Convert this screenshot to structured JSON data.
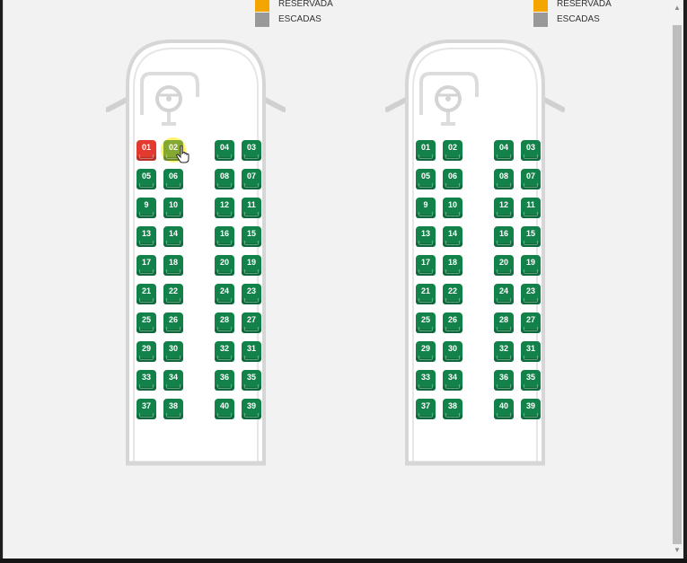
{
  "colors": {
    "available": "#12824a",
    "selected": "#e23a2f",
    "hover": "#84a830",
    "reserved": "#f5a500",
    "stairs": "#999999"
  },
  "legend": [
    {
      "label": "RESERVADA",
      "color": "#f5a500"
    },
    {
      "label": "ESCADAS",
      "color": "#999999"
    }
  ],
  "decks": [
    {
      "icons": [
        "steering-wheel-icon"
      ],
      "rows": [
        [
          "01",
          "02",
          "04",
          "03"
        ],
        [
          "05",
          "06",
          "08",
          "07"
        ],
        [
          "9",
          "10",
          "12",
          "11"
        ],
        [
          "13",
          "14",
          "16",
          "15"
        ],
        [
          "17",
          "18",
          "20",
          "19"
        ],
        [
          "21",
          "22",
          "24",
          "23"
        ],
        [
          "25",
          "26",
          "28",
          "27"
        ],
        [
          "29",
          "30",
          "32",
          "31"
        ],
        [
          "33",
          "34",
          "36",
          "35"
        ],
        [
          "37",
          "38",
          "40",
          "39"
        ]
      ],
      "seat_states": {
        "01": "selected",
        "02": "hover"
      }
    },
    {
      "icons": [
        "steering-wheel-icon"
      ],
      "rows": [
        [
          "01",
          "02",
          "04",
          "03"
        ],
        [
          "05",
          "06",
          "08",
          "07"
        ],
        [
          "9",
          "10",
          "12",
          "11"
        ],
        [
          "13",
          "14",
          "16",
          "15"
        ],
        [
          "17",
          "18",
          "20",
          "19"
        ],
        [
          "21",
          "22",
          "24",
          "23"
        ],
        [
          "25",
          "26",
          "28",
          "27"
        ],
        [
          "29",
          "30",
          "32",
          "31"
        ],
        [
          "33",
          "34",
          "36",
          "35"
        ],
        [
          "37",
          "38",
          "40",
          "39"
        ]
      ],
      "seat_states": {}
    }
  ],
  "pointer": {
    "icon": "hand-pointer-icon",
    "deck": 0,
    "over_seat": "02"
  }
}
